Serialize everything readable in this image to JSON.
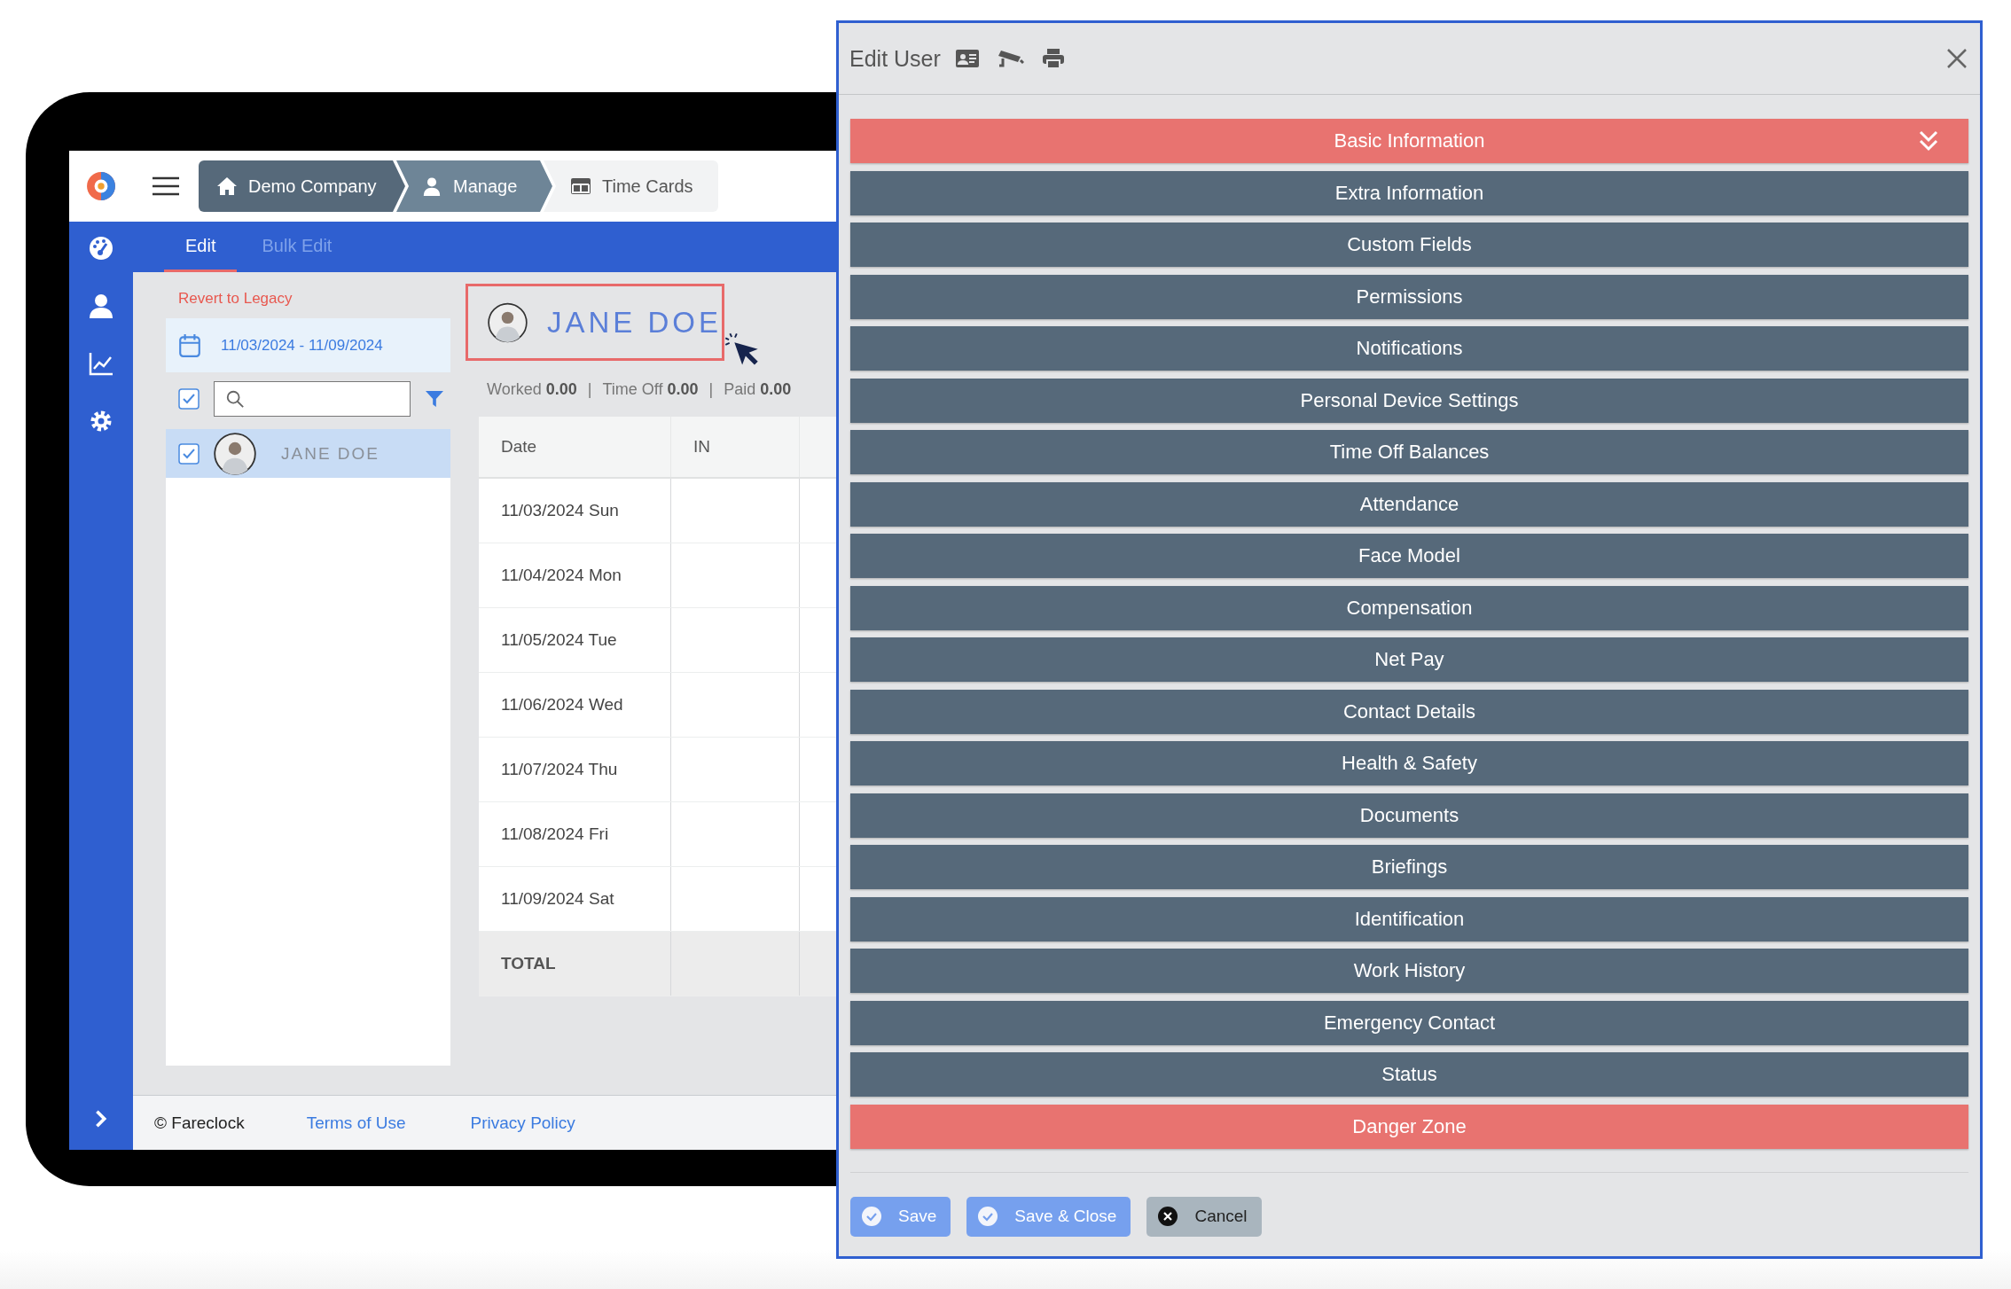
{
  "app": {
    "breadcrumbs": [
      {
        "label": "Demo Company"
      },
      {
        "label": "Manage"
      },
      {
        "label": "Time Cards"
      }
    ],
    "tabs": [
      {
        "label": "Edit",
        "selected": true
      },
      {
        "label": "Bulk Edit",
        "selected": false
      }
    ],
    "revert_link": "Revert to Legacy",
    "date_range": "11/03/2024 - 11/09/2024",
    "select_all": {
      "checked": true
    },
    "employees": [
      {
        "name": "JANE DOE",
        "checked": true,
        "selected": true
      }
    ],
    "employee_title": "JANE DOE",
    "stats": [
      {
        "kind": "stat",
        "label": "Worked",
        "value": "0.00"
      },
      {
        "kind": "separator",
        "text": "|"
      },
      {
        "kind": "stat",
        "label": "Time Off",
        "value": "0.00"
      },
      {
        "kind": "separator",
        "text": "|"
      },
      {
        "kind": "stat",
        "label": "Paid",
        "value": "0.00"
      }
    ],
    "table": {
      "columns": [
        "Date",
        "IN"
      ],
      "rows": [
        {
          "date": "11/03/2024 Sun"
        },
        {
          "date": "11/04/2024 Mon"
        },
        {
          "date": "11/05/2024 Tue"
        },
        {
          "date": "11/06/2024 Wed"
        },
        {
          "date": "11/07/2024 Thu"
        },
        {
          "date": "11/08/2024 Fri"
        },
        {
          "date": "11/09/2024 Sat"
        }
      ],
      "total": "TOTAL"
    },
    "footer": {
      "copyright": "© Fareclock",
      "links": [
        "Terms of Use",
        "Privacy Policy"
      ]
    }
  },
  "dialog": {
    "title": "Edit User",
    "sections": [
      {
        "label": "Basic Information",
        "kind": "section",
        "expanded": true
      },
      {
        "label": "Extra Information",
        "kind": "section",
        "expanded": false
      },
      {
        "label": "Custom Fields",
        "kind": "section",
        "expanded": false
      },
      {
        "label": "Permissions",
        "kind": "section",
        "expanded": false
      },
      {
        "label": "Notifications",
        "kind": "section",
        "expanded": false
      },
      {
        "label": "Personal Device Settings",
        "kind": "section",
        "expanded": false
      },
      {
        "label": "Time Off Balances",
        "kind": "section",
        "expanded": false
      },
      {
        "label": "Attendance",
        "kind": "section",
        "expanded": false
      },
      {
        "label": "Face Model",
        "kind": "section",
        "expanded": false
      },
      {
        "label": "Compensation",
        "kind": "section",
        "expanded": false
      },
      {
        "label": "Net Pay",
        "kind": "section",
        "expanded": false
      },
      {
        "label": "Contact Details",
        "kind": "section",
        "expanded": false
      },
      {
        "label": "Health & Safety",
        "kind": "section",
        "expanded": false
      },
      {
        "label": "Documents",
        "kind": "section",
        "expanded": false
      },
      {
        "label": "Briefings",
        "kind": "section",
        "expanded": false
      },
      {
        "label": "Identification",
        "kind": "section",
        "expanded": false
      },
      {
        "label": "Work History",
        "kind": "section",
        "expanded": false
      },
      {
        "label": "Emergency Contact",
        "kind": "section",
        "expanded": false
      },
      {
        "label": "Status",
        "kind": "section",
        "expanded": false
      },
      {
        "label": "Danger Zone",
        "kind": "danger",
        "expanded": false
      }
    ],
    "buttons": [
      {
        "label": "Save",
        "kind": "primary"
      },
      {
        "label": "Save & Close",
        "kind": "primary"
      },
      {
        "label": "Cancel",
        "kind": "cancel"
      }
    ]
  }
}
